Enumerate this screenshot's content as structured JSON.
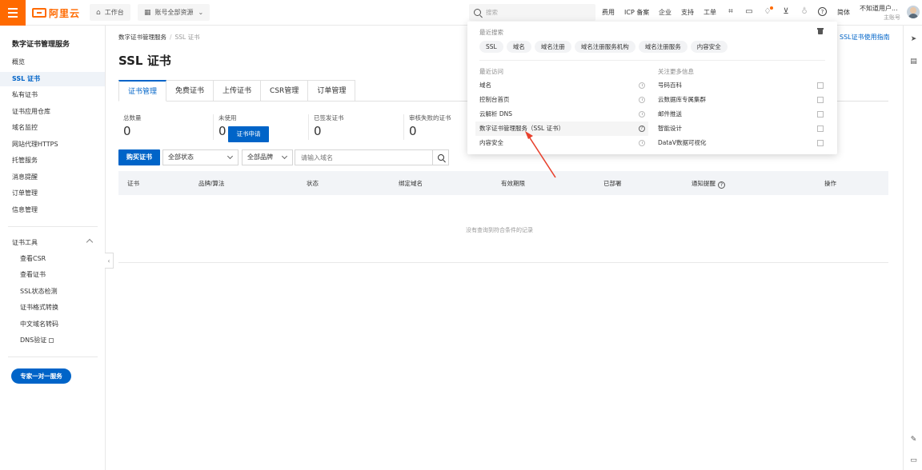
{
  "topbar": {
    "logo_text": "阿里云",
    "workbench": "工作台",
    "resources": "账号全部资源",
    "search_placeholder": "搜索",
    "links": [
      "费用",
      "ICP 备案",
      "企业",
      "支持",
      "工单"
    ],
    "lang": "简体",
    "user_name": "不知道用户...",
    "user_role": "主账号"
  },
  "sidebar": {
    "title": "数字证书管理服务",
    "items": [
      "概览",
      "SSL 证书",
      "私有证书",
      "证书应用仓库",
      "域名监控",
      "网站代理HTTPS",
      "托管服务",
      "消息提醒",
      "订单管理",
      "信息管理"
    ],
    "active_index": 1,
    "tools_group": "证书工具",
    "tools": [
      "查看CSR",
      "查看证书",
      "SSL状态检测",
      "证书格式转换",
      "中文域名转码",
      "DNS验证"
    ],
    "expert_button": "专家一对一服务"
  },
  "main": {
    "breadcrumb": [
      "数字证书管理服务",
      "SSL 证书"
    ],
    "title": "SSL 证书",
    "guide_link": "SSL证书使用指南",
    "tabs": [
      "证书管理",
      "免费证书",
      "上传证书",
      "CSR管理",
      "订单管理"
    ],
    "active_tab": 0,
    "stats": [
      {
        "label": "总数量",
        "value": "0"
      },
      {
        "label": "未使用",
        "value": "0"
      },
      {
        "label": "已签发证书",
        "value": "0"
      },
      {
        "label": "审核失败的证书",
        "value": "0"
      }
    ],
    "apply_button": "证书申请",
    "buy_button": "购买证书",
    "status_select": "全部状态",
    "brand_select": "全部品牌",
    "domain_placeholder": "请输入域名",
    "columns": [
      "证书",
      "品牌/算法",
      "状态",
      "绑定域名",
      "有效期限",
      "已部署",
      "通知提醒",
      "操作"
    ],
    "empty_text": "没有查询到符合条件的记录"
  },
  "dropdown": {
    "recent_search_label": "最近搜索",
    "recent_searches": [
      "SSL",
      "域名",
      "域名注册",
      "域名注册服务机构",
      "域名注册服务",
      "内容安全"
    ],
    "recent_visit_label": "最近访问",
    "recent_visits": [
      "域名",
      "控制台首页",
      "云解析 DNS",
      "数字证书管理服务（SSL 证书）",
      "内容安全"
    ],
    "more_label": "关注更多信息",
    "more_items": [
      "号码百科",
      "云数据库专属集群",
      "邮件推送",
      "智能设计",
      "DataV数据可视化"
    ]
  },
  "colors": {
    "brand_orange": "#ff6a00",
    "primary_blue": "#0064c8",
    "annotation_red": "#e8412d"
  }
}
